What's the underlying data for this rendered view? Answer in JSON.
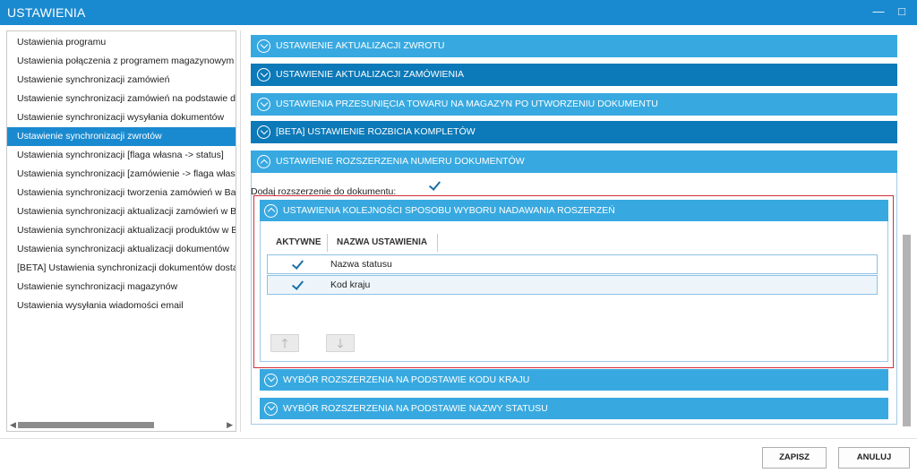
{
  "window": {
    "title": "USTAWIENIA",
    "minimize_icon": "minimize-icon",
    "maximize_icon": "maximize-icon",
    "minimize_glyph": "—",
    "maximize_glyph": "□"
  },
  "sidebar": {
    "items": [
      {
        "label": "Ustawienia programu",
        "active": false
      },
      {
        "label": "Ustawienia połączenia z programem magazynowym",
        "active": false
      },
      {
        "label": "Ustawienie synchronizacji zamówień",
        "active": false
      },
      {
        "label": "Ustawienie synchronizacji zamówień na podstawie dzi",
        "active": false
      },
      {
        "label": "Ustawienie synchronizacji wysyłania dokumentów",
        "active": false
      },
      {
        "label": "Ustawienie synchronizacji zwrotów",
        "active": true
      },
      {
        "label": "Ustawienia synchronizacji [flaga własna -> status]",
        "active": false
      },
      {
        "label": "Ustawienia synchronizacji [zamówienie -> flaga własn",
        "active": false
      },
      {
        "label": "Ustawienia synchronizacji tworzenia zamówień w Base",
        "active": false
      },
      {
        "label": "Ustawienia synchronizacji aktualizacji zamówień w Bas",
        "active": false
      },
      {
        "label": "Ustawienia synchronizacji aktualizacji produktów w Ba",
        "active": false
      },
      {
        "label": "Ustawienia synchronizacji aktualizacji dokumentów",
        "active": false
      },
      {
        "label": "[BETA] Ustawienia synchronizacji dokumentów dostaw",
        "active": false
      },
      {
        "label": "Ustawienie synchronizacji magazynów",
        "active": false
      },
      {
        "label": "Ustawienia wysyłania wiadomości email",
        "active": false
      }
    ],
    "scroll_left_glyph": "◀",
    "scroll_right_glyph": "▶"
  },
  "sections": [
    {
      "label": "USTAWIENIE AKTUALIZACJI ZWROTU",
      "style": "light",
      "expanded": false
    },
    {
      "label": "USTAWIENIE AKTUALIZACJI ZAMÓWIENIA",
      "style": "dark",
      "expanded": false
    },
    {
      "label": "USTAWIENIA PRZESUNIĘCIA TOWARU NA MAGAZYN PO UTWORZENIU DOKUMENTU",
      "style": "light",
      "expanded": false
    },
    {
      "label": "[BETA] USTAWIENIE ROZBICIA KOMPLETÓW",
      "style": "dark",
      "expanded": false
    },
    {
      "label": "USTAWIENIE ROZSZERZENIA NUMERU DOKUMENTÓW",
      "style": "light",
      "expanded": true
    }
  ],
  "extension": {
    "add_label": "Dodaj rozszerzenie do dokumentu:",
    "add_checked": true,
    "order_section_label": "USTAWIENIA KOLEJNOŚCI SPOSOBU WYBORU NADAWANIA ROSZERZEŃ",
    "table": {
      "headers": [
        "AKTYWNE",
        "NAZWA USTAWIENIA"
      ],
      "rows": [
        {
          "active": true,
          "name": "Nazwa statusu"
        },
        {
          "active": true,
          "name": "Kod kraju"
        }
      ]
    },
    "move_up_glyph": "🡑",
    "move_down_glyph": "🡓",
    "country_section_label": "WYBÓR ROZSZERZENIA NA PODSTAWIE KODU KRAJU",
    "status_section_label": "WYBÓR ROZSZERZENIA NA PODSTAWIE NAZWY STATUSU"
  },
  "footer": {
    "save_label": "ZAPISZ",
    "cancel_label": "ANULUJ"
  },
  "colors": {
    "title_bar": "#1a8ad0",
    "bar_light": "#38a9e0",
    "bar_dark": "#0c79b8",
    "highlight_border": "#d42f3a"
  }
}
